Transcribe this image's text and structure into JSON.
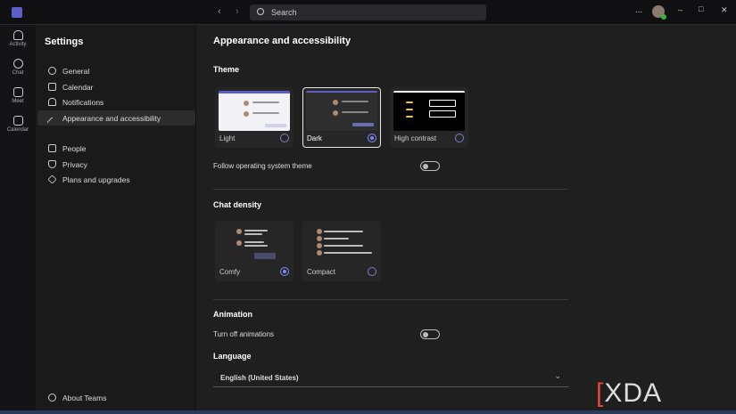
{
  "titlebar": {
    "search_placeholder": "Search",
    "more": "...",
    "minimize": "–",
    "maximize": "□",
    "close": "✕"
  },
  "rail": [
    {
      "label": "Activity"
    },
    {
      "label": "Chat"
    },
    {
      "label": "Meet"
    },
    {
      "label": "Calendar"
    }
  ],
  "settings": {
    "title": "Settings",
    "items": [
      {
        "label": "General"
      },
      {
        "label": "Calendar"
      },
      {
        "label": "Notifications"
      },
      {
        "label": "Appearance and accessibility"
      },
      {
        "label": "People"
      },
      {
        "label": "Privacy"
      },
      {
        "label": "Plans and upgrades"
      }
    ],
    "about": "About Teams"
  },
  "main": {
    "title": "Appearance and accessibility",
    "theme": {
      "heading": "Theme",
      "options": [
        {
          "label": "Light",
          "selected": false
        },
        {
          "label": "Dark",
          "selected": true
        },
        {
          "label": "High contrast",
          "selected": false
        }
      ],
      "follow_os": "Follow operating system theme",
      "follow_os_on": false
    },
    "density": {
      "heading": "Chat density",
      "options": [
        {
          "label": "Comfy",
          "selected": true
        },
        {
          "label": "Compact",
          "selected": false
        }
      ]
    },
    "animation": {
      "heading": "Animation",
      "turn_off": "Turn off animations",
      "turn_off_on": false
    },
    "language": {
      "heading": "Language",
      "value": "English (United States)"
    }
  },
  "watermark": "XDA",
  "colors": {
    "accent": "#7f85f5",
    "bg": "#1f1f1f"
  }
}
